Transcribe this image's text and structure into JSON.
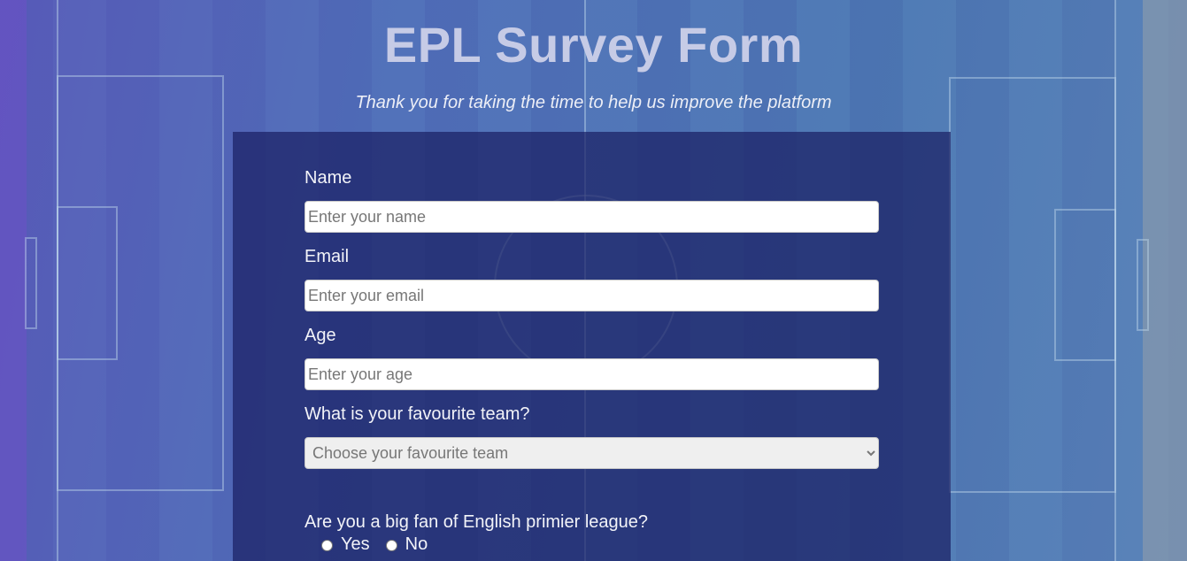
{
  "header": {
    "title": "EPL Survey Form",
    "subtitle": "Thank you for taking the time to help us improve the platform"
  },
  "form": {
    "name": {
      "label": "Name",
      "placeholder": "Enter your name",
      "value": ""
    },
    "email": {
      "label": "Email",
      "placeholder": "Enter your email",
      "value": ""
    },
    "age": {
      "label": "Age",
      "placeholder": "Enter your age",
      "value": ""
    },
    "team": {
      "label": "What is your favourite team?",
      "selected": "Choose your favourite team"
    },
    "fan": {
      "question": "Are you a big fan of English primier league?",
      "options": [
        "Yes",
        "No"
      ]
    }
  },
  "colors": {
    "panel": "#1b2064",
    "title": "#c6cbe6",
    "text": "#f2f3f8"
  }
}
